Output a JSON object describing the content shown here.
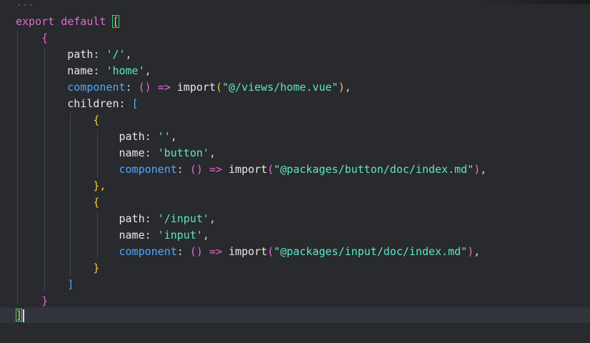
{
  "editor": {
    "fold_marker": "...",
    "lines": {
      "l1": {
        "kw": "export default",
        "open": "["
      },
      "l2": {
        "open": "{"
      },
      "l3": {
        "key": "path",
        "value": "'/'"
      },
      "l4": {
        "key": "name",
        "value": "'home'"
      },
      "l5": {
        "key": "component",
        "import_kw": "import",
        "path": "\"@/views/home.vue\""
      },
      "l6": {
        "key": "children",
        "open": "["
      },
      "l7": {
        "open": "{"
      },
      "l8": {
        "key": "path",
        "value": "''"
      },
      "l9": {
        "key": "name",
        "value": "'button'"
      },
      "l10": {
        "key": "component",
        "import_kw": "import",
        "path": "\"@packages/button/doc/index.md\""
      },
      "l11": {
        "close": "},"
      },
      "l12": {
        "open": "{"
      },
      "l13": {
        "key": "path",
        "value": "'/input'"
      },
      "l14": {
        "key": "name",
        "value": "'input'"
      },
      "l15": {
        "key": "component",
        "import_kw": "import",
        "path": "\"@packages/input/doc/index.md\""
      },
      "l16": {
        "close": "}"
      },
      "l17": {
        "close": "]"
      },
      "l18": {
        "close": "}"
      },
      "l19": {
        "close": "]"
      }
    }
  }
}
